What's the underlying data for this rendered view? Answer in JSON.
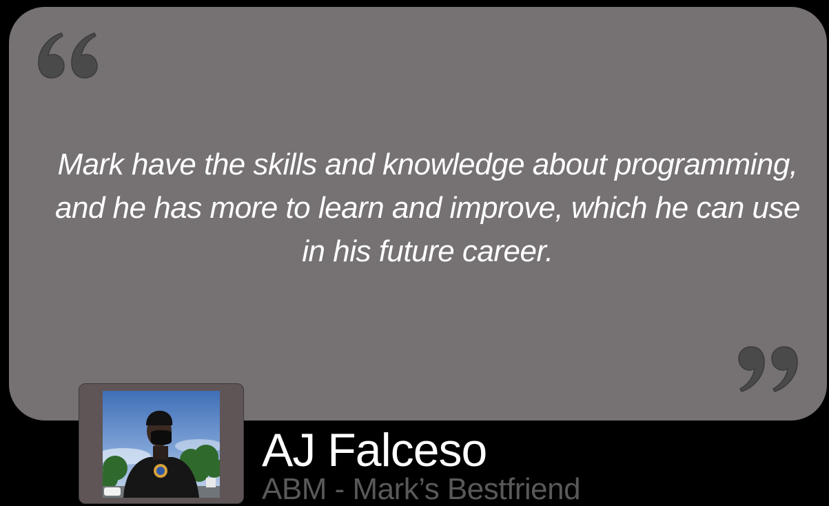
{
  "testimonial": {
    "quote_lines": [
      "Mark have the skills and knowledge about programming,",
      "and he has more to learn and improve, which he can use",
      "in his future career."
    ],
    "author_name": "AJ Falceso",
    "author_role": "ABM - Mark’s Bestfriend"
  },
  "colors": {
    "background": "#000000",
    "card": "#767172",
    "quote_marks": "#4a4a4a",
    "quote_text": "#ffffff",
    "name_text": "#ffffff",
    "role_text": "#595959",
    "photo_frame": "#5f5557"
  },
  "icons": {
    "open_quote": "open-quote-icon",
    "close_quote": "close-quote-icon"
  }
}
